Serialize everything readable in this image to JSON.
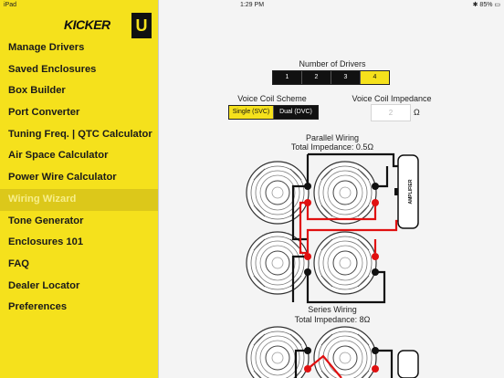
{
  "status": {
    "carrier": "iPad",
    "time": "1:29 PM",
    "battery": "85%"
  },
  "brand": {
    "logo_text": "KICKER",
    "badge": "U"
  },
  "menu": [
    "Manage Drivers",
    "Saved Enclosures",
    "Box Builder",
    "Port Converter",
    "Tuning Freq. | QTC Calculator",
    "Air Space Calculator",
    "Power Wire Calculator",
    "Wiring Wizard",
    "Tone Generator",
    "Enclosures 101",
    "FAQ",
    "Dealer Locator",
    "Preferences"
  ],
  "active_menu": "Wiring Wizard",
  "drivers": {
    "title": "Number of Drivers",
    "options": [
      "1",
      "2",
      "3",
      "4"
    ],
    "selected": "4"
  },
  "coil": {
    "title": "Voice Coil Scheme",
    "options": [
      "Single (SVC)",
      "Dual (DVC)"
    ],
    "selected": "Single (SVC)"
  },
  "impedance": {
    "title": "Voice Coil Impedance",
    "value": "2",
    "unit": "Ω"
  },
  "parallel": {
    "title": "Parallel Wiring",
    "total": "Total Impedance: 0.5Ω"
  },
  "series": {
    "title": "Series Wiring",
    "total": "Total Impedance: 8Ω"
  },
  "amp_label": "AMPLIFIER",
  "colors": {
    "accent": "#f5e11c",
    "wire_red": "#e01010",
    "wire_black": "#111111"
  }
}
